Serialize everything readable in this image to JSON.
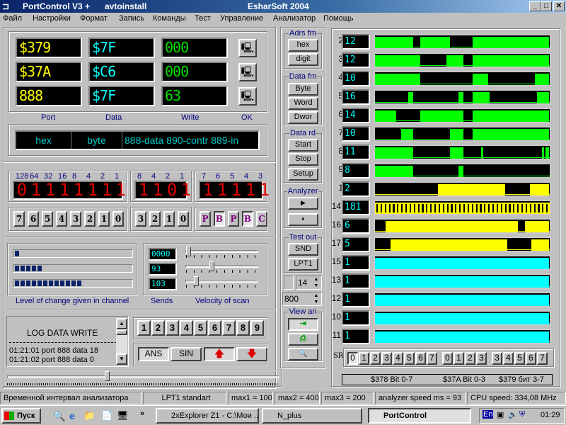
{
  "window": {
    "title": "PortControl  V3 +",
    "subtitle": "avtoinstall",
    "brand": "EsharSoft 2004",
    "min": "_",
    "max": "□",
    "close": "✕"
  },
  "menu": [
    "Файл",
    "Настройки",
    "Формат",
    "Запись",
    "Команды",
    "Тест",
    "Управление",
    "Анализатор",
    "Помощь"
  ],
  "ports": {
    "rows": [
      {
        "port": "$379",
        "data": "$7F",
        "write": "000"
      },
      {
        "port": "$37A",
        "data": "$C6",
        "write": "000"
      },
      {
        "port": "888",
        "data": "$7F",
        "write": "63"
      }
    ],
    "labels": {
      "port": "Port",
      "data": "Data",
      "write": "Write",
      "ok": "OK"
    },
    "colors": {
      "port": "#ffff00",
      "data": "#00ffff",
      "write": "#00e000"
    }
  },
  "format": {
    "mode": "hex",
    "size": "byte",
    "info": "888-data 890-contr 889-in"
  },
  "bits": {
    "data": {
      "weights": [
        "128",
        "64",
        "32",
        "16",
        "8",
        "4",
        "2",
        "1"
      ],
      "values": [
        "0",
        "1",
        "1",
        "1",
        "1",
        "1",
        "1",
        "1"
      ],
      "buttons": [
        "7",
        "6",
        "5",
        "4",
        "3",
        "2",
        "1",
        "0"
      ]
    },
    "control": {
      "weights": [
        "8",
        "4",
        "2",
        "1"
      ],
      "values": [
        "1",
        "1",
        "0",
        "1"
      ],
      "buttons": [
        "3",
        "2",
        "1",
        "0"
      ]
    },
    "status": {
      "weights": [
        "7",
        "6",
        "5",
        "4",
        "3"
      ],
      "values": [
        "1",
        "1",
        "1",
        "1",
        "1"
      ],
      "buttons": [
        "P",
        "B",
        "P",
        "B",
        "C"
      ]
    }
  },
  "levels": {
    "bars": [
      1,
      5,
      12
    ],
    "bar_max": 22,
    "caption": "Level of change given in channel"
  },
  "sends": {
    "values": [
      "0000",
      "93",
      "103"
    ],
    "caption": "Sends",
    "slider_caption": "Velocity of scan",
    "slider_percent": [
      0,
      35,
      12
    ]
  },
  "log": {
    "title": "LOG  DATA  WRITE",
    "lines": [
      "01:21:01 port 888 data 18",
      "01:21:02 port 888 data 0"
    ]
  },
  "numbuttons": [
    "1",
    "2",
    "3",
    "4",
    "5",
    "6",
    "7",
    "8",
    "9"
  ],
  "mode_buttons": {
    "ans": "ANS",
    "sin": "SIN"
  },
  "bottom_slider_percent": 36,
  "side": {
    "adrs": {
      "title": "Adrs fm",
      "buttons": [
        "hex",
        "digit"
      ]
    },
    "datafm": {
      "title": "Data fm",
      "buttons": [
        "Byte",
        "Word",
        "Dwor"
      ]
    },
    "datard": {
      "title": "Data rd",
      "buttons": [
        "Start",
        "Stop",
        "Setup"
      ]
    },
    "analyzer": {
      "title": "Analyzer"
    },
    "testout": {
      "title": "Test out",
      "buttons": [
        "SND",
        "LPT1"
      ]
    },
    "spin1": "14",
    "spin2": "800",
    "view": {
      "title": "View an"
    }
  },
  "channels": [
    {
      "n": "2",
      "v": "12",
      "color": "#00ff00",
      "high": [
        [
          0,
          22
        ],
        [
          26,
          43
        ],
        [
          56,
          100
        ]
      ]
    },
    {
      "n": "3",
      "v": "12",
      "color": "#00ff00",
      "high": [
        [
          0,
          26
        ],
        [
          41,
          51
        ],
        [
          56,
          100
        ]
      ]
    },
    {
      "n": "4",
      "v": "10",
      "color": "#00ff00",
      "high": [
        [
          0,
          26
        ],
        [
          56,
          65
        ],
        [
          92,
          100
        ]
      ]
    },
    {
      "n": "5",
      "v": "16",
      "color": "#00ff00",
      "high": [
        [
          19,
          22
        ],
        [
          48,
          51
        ],
        [
          56,
          66
        ],
        [
          93,
          100
        ]
      ]
    },
    {
      "n": "6",
      "v": "14",
      "color": "#00ff00",
      "high": [
        [
          0,
          12
        ],
        [
          26,
          51
        ],
        [
          56,
          100
        ]
      ]
    },
    {
      "n": "7",
      "v": "10",
      "color": "#00ff00",
      "high": [
        [
          15,
          22
        ],
        [
          43,
          51
        ],
        [
          56,
          100
        ]
      ]
    },
    {
      "n": "8",
      "v": "11",
      "color": "#00ff00",
      "high": [
        [
          0,
          22
        ],
        [
          43,
          51
        ],
        [
          61,
          62
        ],
        [
          96,
          97
        ],
        [
          98,
          100
        ]
      ]
    },
    {
      "n": "9",
      "v": "8",
      "color": "#00ff00",
      "high": [
        [
          0,
          22
        ],
        [
          48,
          51
        ]
      ]
    },
    {
      "n": "1",
      "v": "2",
      "color": "#ffff00",
      "high": [
        [
          36,
          75
        ],
        [
          89,
          100
        ]
      ]
    },
    {
      "n": "14",
      "v": "181",
      "color": "#ffff00",
      "clock": true
    },
    {
      "n": "16",
      "v": "6",
      "color": "#ffff00",
      "high": [
        [
          6,
          82
        ],
        [
          86,
          100
        ]
      ]
    },
    {
      "n": "17",
      "v": "5",
      "color": "#ffff00",
      "high": [
        [
          9,
          76
        ],
        [
          90,
          100
        ]
      ]
    },
    {
      "n": "15",
      "v": "1",
      "color": "#00ffff",
      "high": [
        [
          0,
          100
        ]
      ]
    },
    {
      "n": "13",
      "v": "1",
      "color": "#00ffff",
      "high": [
        [
          0,
          100
        ]
      ]
    },
    {
      "n": "12",
      "v": "1",
      "color": "#00ffff",
      "high": [
        [
          0,
          100
        ]
      ]
    },
    {
      "n": "10",
      "v": "1",
      "color": "#00ffff",
      "high": [
        [
          0,
          100
        ]
      ]
    },
    {
      "n": "11",
      "v": "1",
      "color": "#00ffff",
      "high": [
        [
          0,
          100
        ]
      ]
    }
  ],
  "sr": {
    "label": "SR",
    "buttons": [
      "0",
      "1",
      "2",
      "3",
      "4",
      "5",
      "6",
      "7",
      "0",
      "1",
      "2",
      "3",
      "3",
      "4",
      "5",
      "6",
      "7"
    ]
  },
  "legend": {
    "a": "$378  Bit 0-7",
    "b": "$37A  Bit 0-3",
    "c": "$379 бит 3-7"
  },
  "status": [
    "Временной интервал анализатора",
    "LPT1 standart",
    "max1 = 100",
    "max2 = 400",
    "max3 = 200",
    "analyzer speed ms = 93",
    "CPU speed: 334,08 MHz"
  ],
  "taskbar": {
    "start": "Пуск",
    "tasks": [
      "2xExplorer Z1 - C:\\Мои ...",
      "N_plus",
      "PortControl"
    ],
    "lang": "En",
    "clock": "01:29"
  }
}
